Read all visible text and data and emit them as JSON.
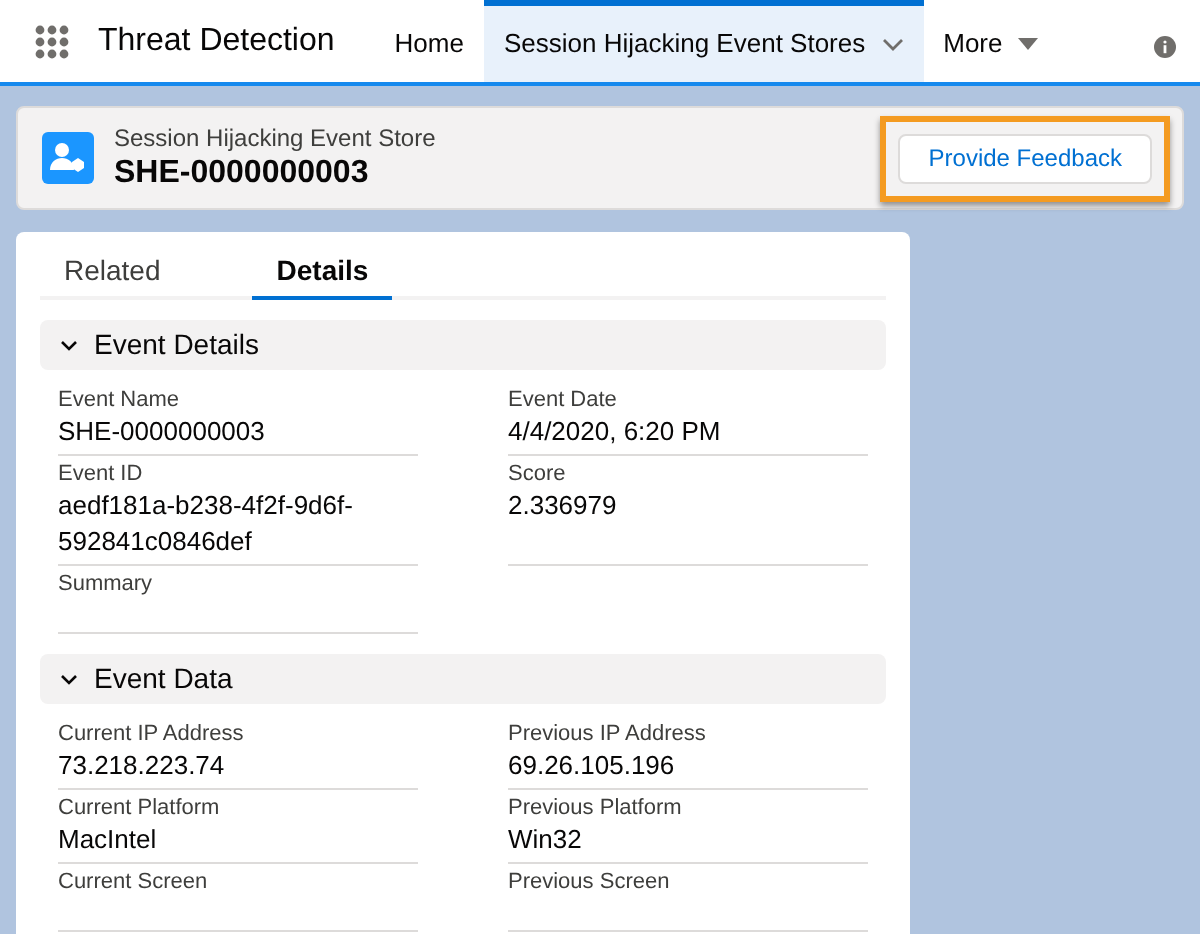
{
  "app": {
    "title": "Threat Detection"
  },
  "nav_tabs": [
    {
      "label": "Home",
      "selected": false,
      "kind": "plain"
    },
    {
      "label": "Session Hijacking Event Stores",
      "selected": true,
      "kind": "dropdown"
    },
    {
      "label": "More",
      "selected": false,
      "kind": "more"
    }
  ],
  "record_header": {
    "object_type": "Session Hijacking Event Store",
    "name": "SHE-0000000003",
    "button": "Provide Feedback",
    "button_highlighted": true
  },
  "detail_tabs": [
    {
      "label": "Related",
      "selected": false
    },
    {
      "label": "Details",
      "selected": true
    }
  ],
  "sections": [
    {
      "title": "Event Details",
      "expanded": true,
      "fields": [
        {
          "label": "Event Name",
          "value": "SHE-0000000003"
        },
        {
          "label": "Event Date",
          "value": "4/4/2020, 6:20 PM"
        },
        {
          "label": "Event ID",
          "value": "aedf181a-b238-4f2f-9d6f-592841c0846def"
        },
        {
          "label": "Score",
          "value": "2.336979"
        },
        {
          "label": "Summary"
        }
      ]
    },
    {
      "title": "Event Data",
      "expanded": true,
      "fields": [
        {
          "label": "Current IP Address",
          "value": "73.218.223.74"
        },
        {
          "label": "Previous IP Address",
          "value": "69.26.105.196"
        },
        {
          "label": "Current Platform",
          "value": "MacIntel"
        },
        {
          "label": "Previous Platform",
          "value": "Win32"
        },
        {
          "label": "Current Screen"
        },
        {
          "label": "Previous Screen"
        }
      ]
    }
  ]
}
